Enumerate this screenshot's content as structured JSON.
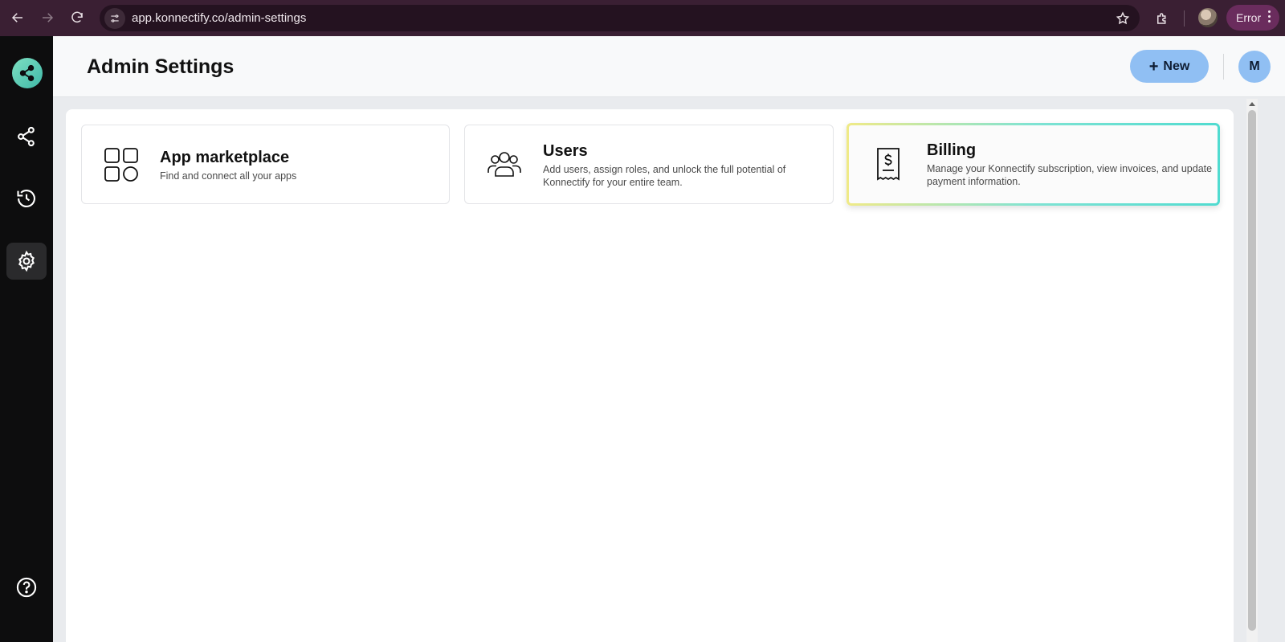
{
  "browser": {
    "url": "app.konnectify.co/admin-settings",
    "error_label": "Error"
  },
  "sidebar": {
    "items": [
      {
        "name": "workflows",
        "icon": "share-nodes-icon"
      },
      {
        "name": "history",
        "icon": "history-icon"
      },
      {
        "name": "settings",
        "icon": "gear-icon",
        "active": true
      },
      {
        "name": "help",
        "icon": "help-icon"
      }
    ]
  },
  "header": {
    "title": "Admin Settings",
    "new_label": "New",
    "avatar_initial": "M"
  },
  "cards": [
    {
      "title": "App marketplace",
      "desc_line1": "Find and connect all your apps",
      "desc_line2": "",
      "icon": "apps-grid-icon"
    },
    {
      "title": "Users",
      "desc_line1": "Add users, assign roles, and unlock the full potential of",
      "desc_line2": "Konnectify for your entire team.",
      "icon": "users-icon"
    },
    {
      "title": "Billing",
      "desc_line1": "Manage your Konnectify subscription, view invoices, and update",
      "desc_line2": "payment information.",
      "icon": "receipt-icon",
      "highlighted": true
    }
  ],
  "colors": {
    "primary_button": "#90bff3",
    "sidebar_bg": "#0d0d0e",
    "browser_bar": "#3a1f33"
  }
}
